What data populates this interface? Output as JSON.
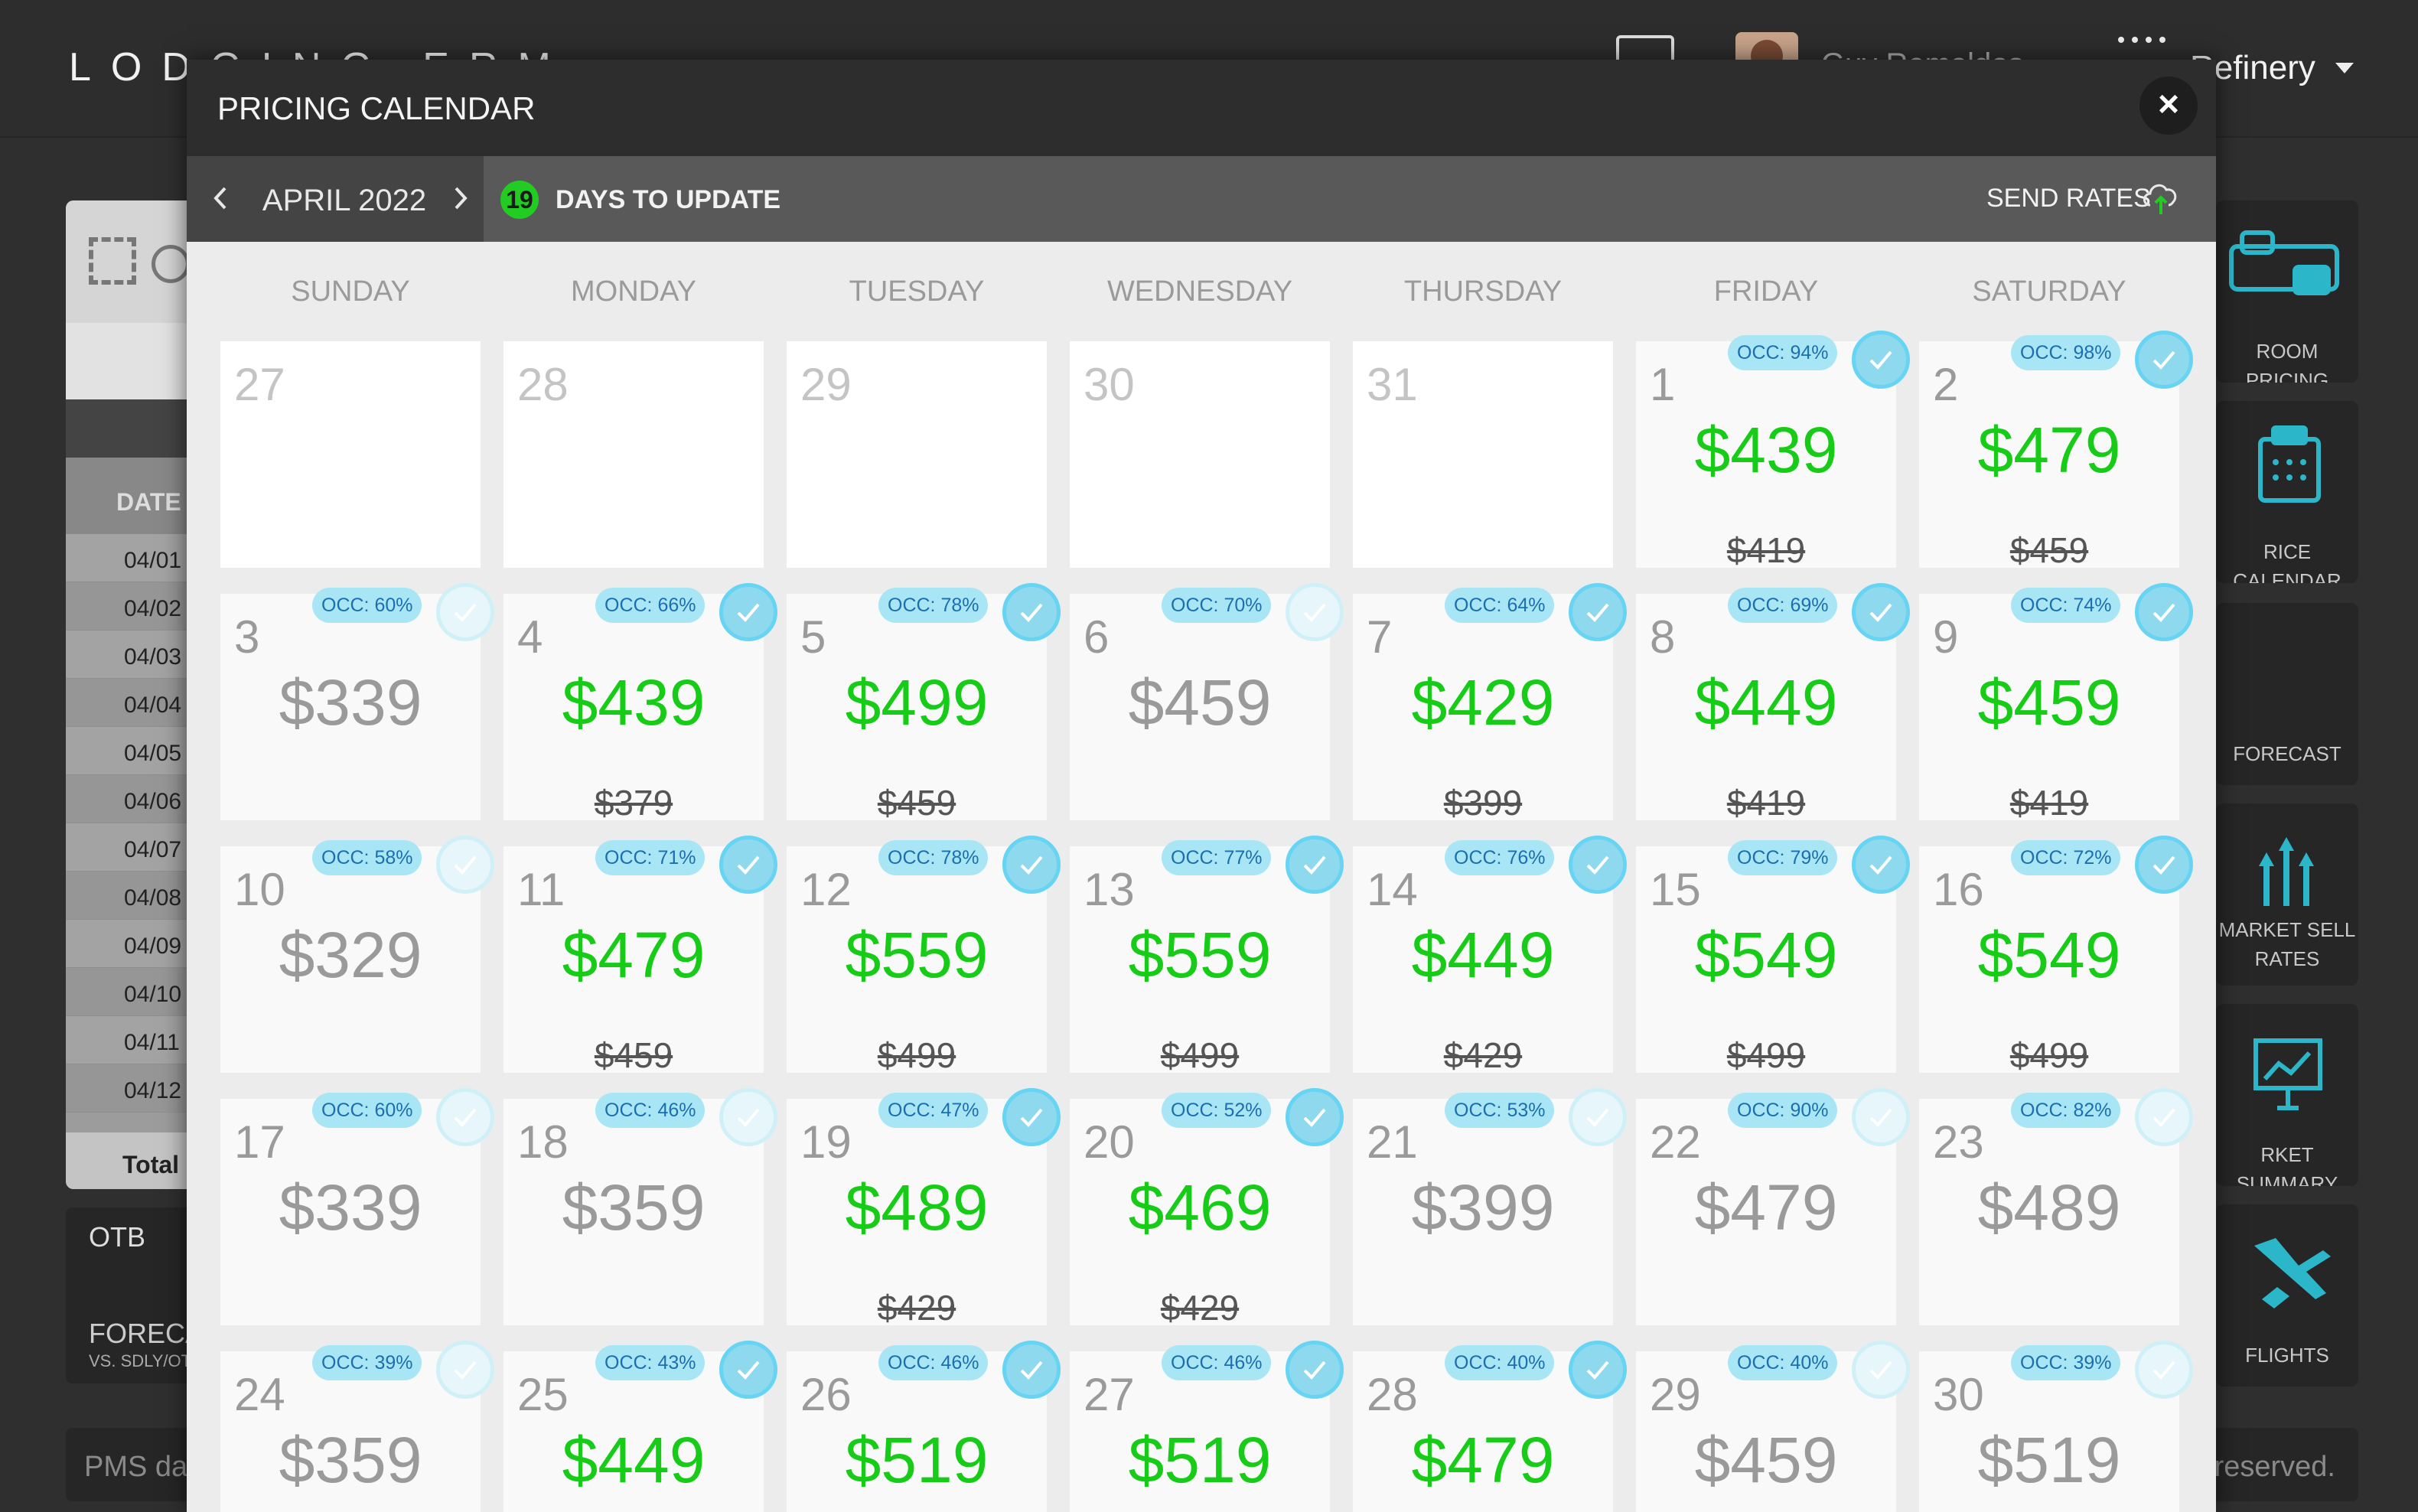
{
  "app": {
    "logo": "LODGING ERM",
    "user": "Guy Remaldos",
    "hotel": "Refinery",
    "sidebar_header": "DATE",
    "sidebar_dates": [
      "04/01",
      "04/02",
      "04/03",
      "04/04",
      "04/05",
      "04/06",
      "04/07",
      "04/08",
      "04/09",
      "04/10",
      "04/11",
      "04/12"
    ],
    "sidebar_total": "Total",
    "otb_label": "OTB",
    "forecast_label": "FORECA",
    "forecast_sub": "VS. SDLY/OT",
    "footer_left": "PMS da",
    "footer_right": "s reserved.",
    "tiles": [
      "ROOM PRICING",
      "RICE CALENDAR",
      "FORECAST",
      "MARKET SELL RATES",
      "RKET SUMMARY",
      "FLIGHTS"
    ]
  },
  "modal": {
    "title": "PRICING CALENDAR",
    "close": "×",
    "month": "APRIL 2022",
    "days_count": "19",
    "days_label": "DAYS TO UPDATE",
    "send_rates": "SEND RATES",
    "weekdays": [
      "SUNDAY",
      "MONDAY",
      "TUESDAY",
      "WEDNESDAY",
      "THURSDAY",
      "FRIDAY",
      "SATURDAY"
    ]
  },
  "colors": {
    "green": "#17cc17",
    "gray_price": "#9a9a9a",
    "occ_badge": "#a8e6f6",
    "check": "#66d4f2",
    "badge_green": "#22cc22"
  },
  "calendar": [
    [
      {
        "day": "27",
        "empty": true
      },
      {
        "day": "28",
        "empty": true
      },
      {
        "day": "29",
        "empty": true
      },
      {
        "day": "30",
        "empty": true
      },
      {
        "day": "31",
        "empty": true
      },
      {
        "day": "1",
        "occ": "OCC: 94%",
        "price": "$439",
        "old": "$419",
        "green": true,
        "checked": true
      },
      {
        "day": "2",
        "occ": "OCC: 98%",
        "price": "$479",
        "old": "$459",
        "green": true,
        "checked": true
      }
    ],
    [
      {
        "day": "3",
        "occ": "OCC: 60%",
        "price": "$339",
        "old": "",
        "green": false,
        "checked": false
      },
      {
        "day": "4",
        "occ": "OCC: 66%",
        "price": "$439",
        "old": "$379",
        "green": true,
        "checked": true
      },
      {
        "day": "5",
        "occ": "OCC: 78%",
        "price": "$499",
        "old": "$459",
        "green": true,
        "checked": true
      },
      {
        "day": "6",
        "occ": "OCC: 70%",
        "price": "$459",
        "old": "",
        "green": false,
        "checked": false
      },
      {
        "day": "7",
        "occ": "OCC: 64%",
        "price": "$429",
        "old": "$399",
        "green": true,
        "checked": true
      },
      {
        "day": "8",
        "occ": "OCC: 69%",
        "price": "$449",
        "old": "$419",
        "green": true,
        "checked": true
      },
      {
        "day": "9",
        "occ": "OCC: 74%",
        "price": "$459",
        "old": "$419",
        "green": true,
        "checked": true
      }
    ],
    [
      {
        "day": "10",
        "occ": "OCC: 58%",
        "price": "$329",
        "old": "",
        "green": false,
        "checked": false
      },
      {
        "day": "11",
        "occ": "OCC: 71%",
        "price": "$479",
        "old": "$459",
        "green": true,
        "checked": true
      },
      {
        "day": "12",
        "occ": "OCC: 78%",
        "price": "$559",
        "old": "$499",
        "green": true,
        "checked": true
      },
      {
        "day": "13",
        "occ": "OCC: 77%",
        "price": "$559",
        "old": "$499",
        "green": true,
        "checked": true
      },
      {
        "day": "14",
        "occ": "OCC: 76%",
        "price": "$449",
        "old": "$429",
        "green": true,
        "checked": true
      },
      {
        "day": "15",
        "occ": "OCC: 79%",
        "price": "$549",
        "old": "$499",
        "green": true,
        "checked": true
      },
      {
        "day": "16",
        "occ": "OCC: 72%",
        "price": "$549",
        "old": "$499",
        "green": true,
        "checked": true
      }
    ],
    [
      {
        "day": "17",
        "occ": "OCC: 60%",
        "price": "$339",
        "old": "",
        "green": false,
        "checked": false
      },
      {
        "day": "18",
        "occ": "OCC: 46%",
        "price": "$359",
        "old": "",
        "green": false,
        "checked": false
      },
      {
        "day": "19",
        "occ": "OCC: 47%",
        "price": "$489",
        "old": "$429",
        "green": true,
        "checked": true
      },
      {
        "day": "20",
        "occ": "OCC: 52%",
        "price": "$469",
        "old": "$429",
        "green": true,
        "checked": true
      },
      {
        "day": "21",
        "occ": "OCC: 53%",
        "price": "$399",
        "old": "",
        "green": false,
        "checked": false
      },
      {
        "day": "22",
        "occ": "OCC: 90%",
        "price": "$479",
        "old": "",
        "green": false,
        "checked": false
      },
      {
        "day": "23",
        "occ": "OCC: 82%",
        "price": "$489",
        "old": "",
        "green": false,
        "checked": false
      }
    ],
    [
      {
        "day": "24",
        "occ": "OCC: 39%",
        "price": "$359",
        "old": "",
        "green": false,
        "checked": false
      },
      {
        "day": "25",
        "occ": "OCC: 43%",
        "price": "$449",
        "old": "",
        "green": true,
        "checked": true
      },
      {
        "day": "26",
        "occ": "OCC: 46%",
        "price": "$519",
        "old": "",
        "green": true,
        "checked": true
      },
      {
        "day": "27",
        "occ": "OCC: 46%",
        "price": "$519",
        "old": "",
        "green": true,
        "checked": true
      },
      {
        "day": "28",
        "occ": "OCC: 40%",
        "price": "$479",
        "old": "",
        "green": true,
        "checked": true
      },
      {
        "day": "29",
        "occ": "OCC: 40%",
        "price": "$459",
        "old": "",
        "green": false,
        "checked": false
      },
      {
        "day": "30",
        "occ": "OCC: 39%",
        "price": "$519",
        "old": "",
        "green": false,
        "checked": false
      }
    ]
  ]
}
